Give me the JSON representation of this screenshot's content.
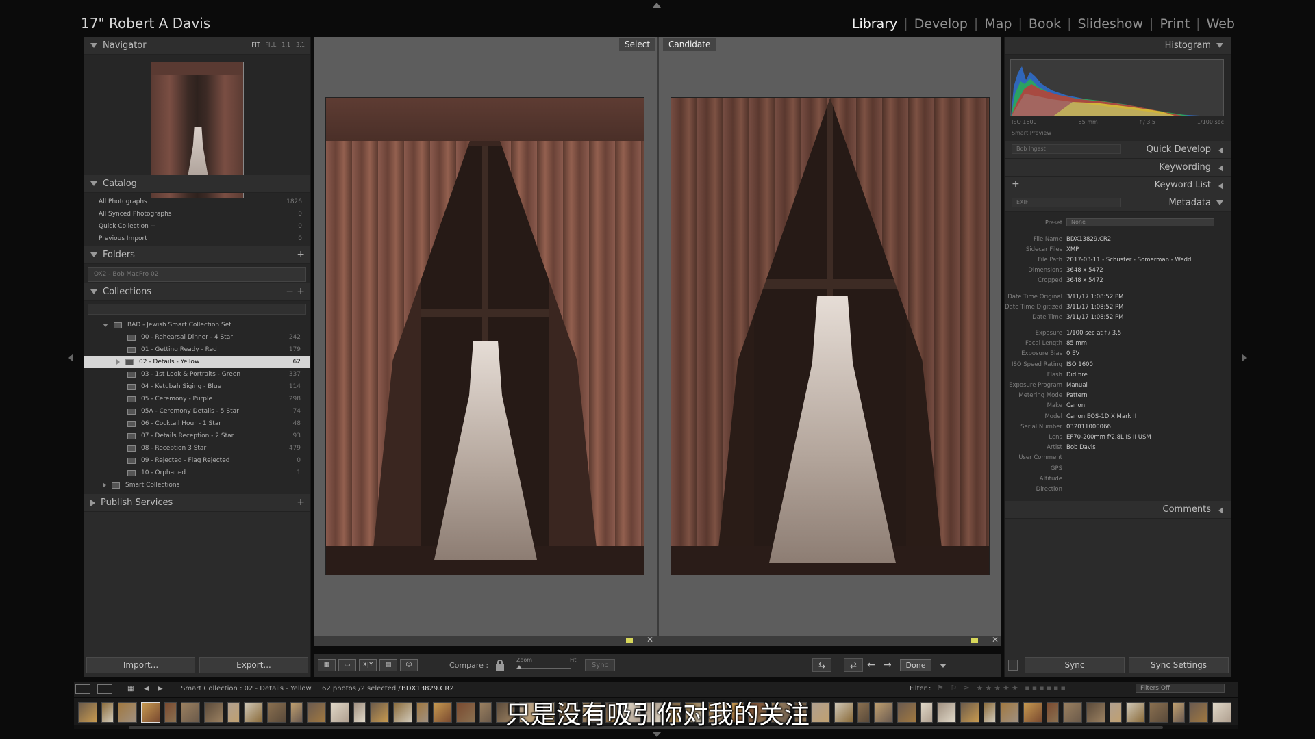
{
  "window": {
    "catalog_title": "17\" Robert A Davis"
  },
  "modules": [
    {
      "label": "Library",
      "active": true
    },
    {
      "label": "Develop",
      "active": false
    },
    {
      "label": "Map",
      "active": false
    },
    {
      "label": "Book",
      "active": false
    },
    {
      "label": "Slideshow",
      "active": false
    },
    {
      "label": "Print",
      "active": false
    },
    {
      "label": "Web",
      "active": false
    }
  ],
  "navigator": {
    "title": "Navigator",
    "zoom_options": [
      "FIT",
      "FILL",
      "1:1",
      "3:1"
    ]
  },
  "catalog": {
    "title": "Catalog",
    "items": [
      {
        "label": "All Photographs",
        "count": "1826"
      },
      {
        "label": "All Synced Photographs",
        "count": "0"
      },
      {
        "label": "Quick Collection +",
        "count": "0"
      },
      {
        "label": "Previous Import",
        "count": "0"
      }
    ]
  },
  "folders": {
    "title": "Folders",
    "add": "+",
    "volume": "OX2 - Bob MacPro 02"
  },
  "collections": {
    "title": "Collections",
    "minus": "−",
    "add": "+",
    "set_name": "BAD - Jewish Smart Collection Set",
    "items": [
      {
        "label": "00 - Rehearsal Dinner - 4 Star",
        "count": "242",
        "selected": false
      },
      {
        "label": "01 - Getting Ready - Red",
        "count": "179",
        "selected": false
      },
      {
        "label": "02 - Details - Yellow",
        "count": "62",
        "selected": true
      },
      {
        "label": "03 - 1st Look & Portraits - Green",
        "count": "337",
        "selected": false
      },
      {
        "label": "04 - Ketubah Siging - Blue",
        "count": "114",
        "selected": false
      },
      {
        "label": "05 - Ceremony - Purple",
        "count": "298",
        "selected": false
      },
      {
        "label": "05A - Ceremony Details - 5 Star",
        "count": "74",
        "selected": false
      },
      {
        "label": "06 - Cocktail Hour - 1 Star",
        "count": "48",
        "selected": false
      },
      {
        "label": "07 - Details Reception - 2 Star",
        "count": "93",
        "selected": false
      },
      {
        "label": "08 - Reception 3 Star",
        "count": "479",
        "selected": false
      },
      {
        "label": "09 - Rejected - Flag Rejected",
        "count": "0",
        "selected": false
      },
      {
        "label": "10 - Orphaned",
        "count": "1",
        "selected": false
      }
    ],
    "smart_collections": "Smart Collections"
  },
  "publish_services": {
    "title": "Publish Services",
    "add": "+"
  },
  "left_buttons": {
    "import": "Import...",
    "export": "Export..."
  },
  "compare": {
    "select_label": "Select",
    "candidate_label": "Candidate",
    "compare_label": "Compare :",
    "zoom_label": "Zoom",
    "fit_label": "Fit",
    "sync_label": "Sync",
    "done_label": "Done",
    "xy_label": "X|Y"
  },
  "histogram": {
    "title": "Histogram",
    "iso": "ISO 1600",
    "focal": "85 mm",
    "aperture": "f / 3.5",
    "shutter": "1/100 sec",
    "smart_preview": "Smart Preview"
  },
  "quick_develop": {
    "title": "Quick Develop",
    "preset": "Bob Ingest"
  },
  "keywording": {
    "title": "Keywording"
  },
  "keyword_list": {
    "title": "Keyword List",
    "add": "+"
  },
  "metadata": {
    "title": "Metadata",
    "view": "EXIF",
    "preset_label": "Preset",
    "preset_value": "None",
    "groups": [
      [
        {
          "label": "File Name",
          "value": "BDX13829.CR2"
        },
        {
          "label": "Sidecar Files",
          "value": "XMP"
        },
        {
          "label": "File Path",
          "value": "2017-03-11 - Schuster - Somerman - Weddi"
        },
        {
          "label": "Dimensions",
          "value": "3648 x 5472"
        },
        {
          "label": "Cropped",
          "value": "3648 x 5472"
        }
      ],
      [
        {
          "label": "Date Time Original",
          "value": "3/11/17 1:08:52 PM"
        },
        {
          "label": "Date Time Digitized",
          "value": "3/11/17 1:08:52 PM"
        },
        {
          "label": "Date Time",
          "value": "3/11/17 1:08:52 PM"
        }
      ],
      [
        {
          "label": "Exposure",
          "value": "1/100 sec at f / 3.5"
        },
        {
          "label": "Focal Length",
          "value": "85 mm"
        },
        {
          "label": "Exposure Bias",
          "value": "0 EV"
        },
        {
          "label": "ISO Speed Rating",
          "value": "ISO 1600"
        },
        {
          "label": "Flash",
          "value": "Did fire"
        },
        {
          "label": "Exposure Program",
          "value": "Manual"
        },
        {
          "label": "Metering Mode",
          "value": "Pattern"
        },
        {
          "label": "Make",
          "value": "Canon"
        },
        {
          "label": "Model",
          "value": "Canon EOS-1D X Mark II"
        },
        {
          "label": "Serial Number",
          "value": "032011000066"
        },
        {
          "label": "Lens",
          "value": "EF70-200mm f/2.8L IS II USM"
        },
        {
          "label": "Artist",
          "value": "Bob Davis"
        },
        {
          "label": "User Comment",
          "value": ""
        },
        {
          "label": "GPS",
          "value": ""
        },
        {
          "label": "Altitude",
          "value": ""
        },
        {
          "label": "Direction",
          "value": ""
        }
      ]
    ]
  },
  "comments": {
    "title": "Comments"
  },
  "right_buttons": {
    "sync": "Sync",
    "sync_settings": "Sync Settings"
  },
  "filmstrip_bar": {
    "source": "Smart Collection : 02 - Details - Yellow",
    "count": "62 photos /2 selected /",
    "current_file": "BDX13829.CR2",
    "filter_label": "Filter :",
    "filter_value": "Filters Off"
  },
  "subtitle": "只是没有吸引你对我的关注"
}
